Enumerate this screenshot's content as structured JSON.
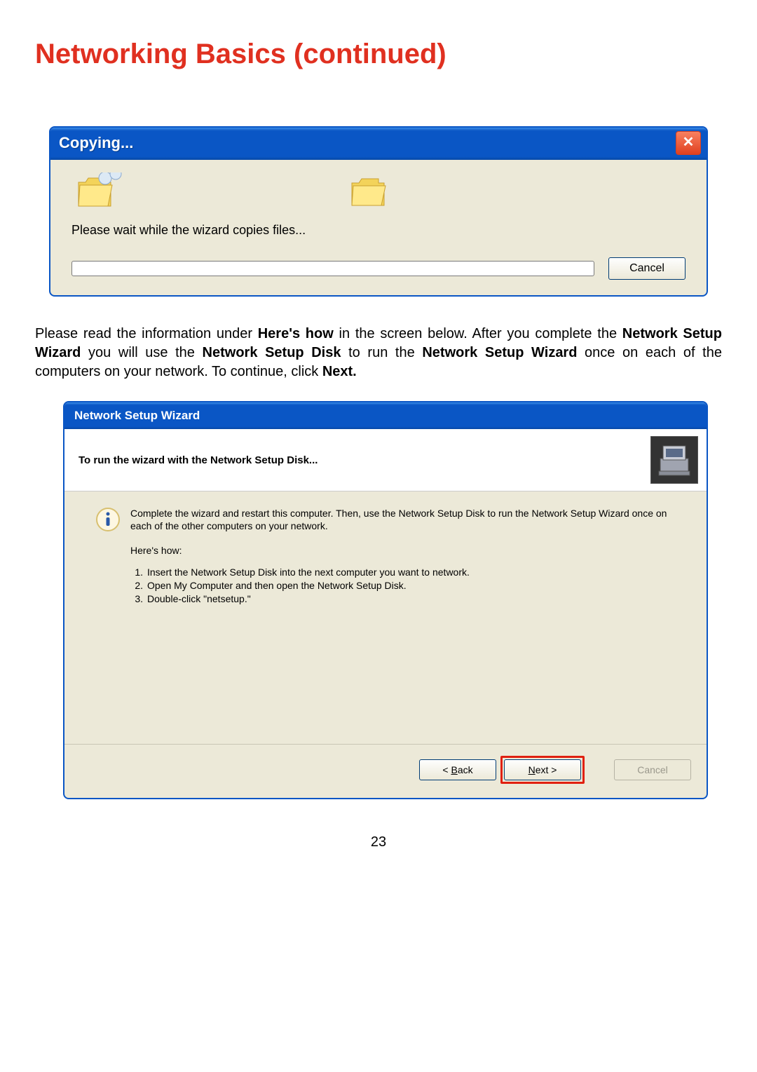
{
  "page": {
    "title": "Networking Basics (continued)",
    "number": "23"
  },
  "dlg1": {
    "title": "Copying...",
    "message": "Please wait while the wizard copies files...",
    "cancel": "Cancel"
  },
  "paragraph": {
    "t1": "Please read the information under ",
    "b1": "Here's how",
    "t2": " in the screen below. After you complete the ",
    "b2": "Network Setup Wizard",
    "t3": " you will use the ",
    "b3": "Network Setup Disk",
    "t4": " to run the ",
    "b4": "Network Setup Wizard",
    "t5": " once on each of the computers on your network. To continue, click ",
    "b5": "Next.",
    "t6": ""
  },
  "dlg2": {
    "title": "Network Setup Wizard",
    "heading": "To run the wizard with the Network Setup Disk...",
    "info": "Complete the wizard and restart this computer. Then, use the Network Setup Disk to run the Network Setup Wizard once on each of the other computers on your network.",
    "heres_how": "Here's how:",
    "steps": {
      "n1": "1.",
      "s1": "Insert the Network Setup Disk into the next computer you want to network.",
      "n2": "2.",
      "s2": "Open My Computer and then open the Network Setup Disk.",
      "n3": "3.",
      "s3": "Double-click \"netsetup.\""
    },
    "buttons": {
      "back_pre": "< ",
      "back_u": "B",
      "back_post": "ack",
      "next_u": "N",
      "next_post": "ext >",
      "cancel": "Cancel"
    }
  }
}
